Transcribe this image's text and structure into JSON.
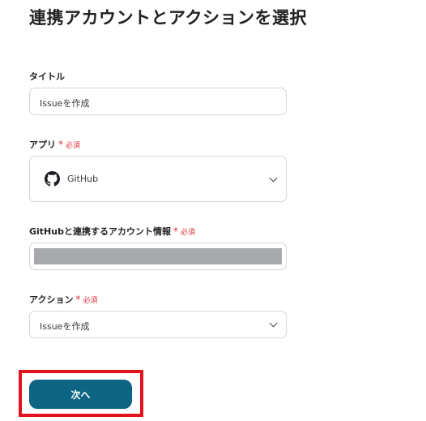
{
  "page": {
    "title": "連携アカウントとアクションを選択"
  },
  "form": {
    "title_field": {
      "label": "タイトル",
      "value": "Issueを作成"
    },
    "app_field": {
      "label": "アプリ",
      "required": "必須",
      "value": "GitHub",
      "icon": "github-icon"
    },
    "account_field": {
      "label": "GitHubと連携するアカウント情報",
      "required": "必須"
    },
    "action_field": {
      "label": "アクション",
      "required": "必須",
      "value": "Issueを作成"
    }
  },
  "footer": {
    "next_label": "次へ"
  },
  "colors": {
    "primary": "#0d6483",
    "required": "#e0323b",
    "highlight": "#e3131b"
  }
}
